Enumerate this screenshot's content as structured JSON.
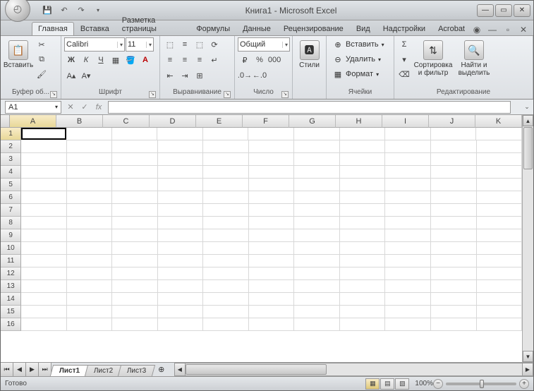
{
  "title": "Книга1 - Microsoft Excel",
  "tabs": [
    "Главная",
    "Вставка",
    "Разметка страницы",
    "Формулы",
    "Данные",
    "Рецензирование",
    "Вид",
    "Надстройки",
    "Acrobat"
  ],
  "active_tab": 0,
  "ribbon": {
    "clipboard": {
      "paste": "Вставить",
      "label": "Буфер об..."
    },
    "font": {
      "name": "Calibri",
      "size": "11",
      "label": "Шрифт",
      "bold": "Ж",
      "italic": "К",
      "underline": "Ч"
    },
    "alignment": {
      "label": "Выравнивание"
    },
    "number": {
      "format": "Общий",
      "label": "Число",
      "percent": "%",
      "thousands": "000"
    },
    "styles": {
      "label": "Стили"
    },
    "cells": {
      "insert": "Вставить",
      "delete": "Удалить",
      "format": "Формат",
      "label": "Ячейки"
    },
    "editing": {
      "autosum": "Σ",
      "sort": "Сортировка и фильтр",
      "find": "Найти и выделить",
      "label": "Редактирование"
    }
  },
  "namebox": "A1",
  "fx_label": "fx",
  "columns": [
    "A",
    "B",
    "C",
    "D",
    "E",
    "F",
    "G",
    "H",
    "I",
    "J",
    "K"
  ],
  "rows": [
    1,
    2,
    3,
    4,
    5,
    6,
    7,
    8,
    9,
    10,
    11,
    12,
    13,
    14,
    15,
    16
  ],
  "active_cell": {
    "row": 1,
    "col": "A"
  },
  "sheets": [
    "Лист1",
    "Лист2",
    "Лист3"
  ],
  "active_sheet": 0,
  "status": {
    "ready": "Готово",
    "zoom": "100%"
  }
}
